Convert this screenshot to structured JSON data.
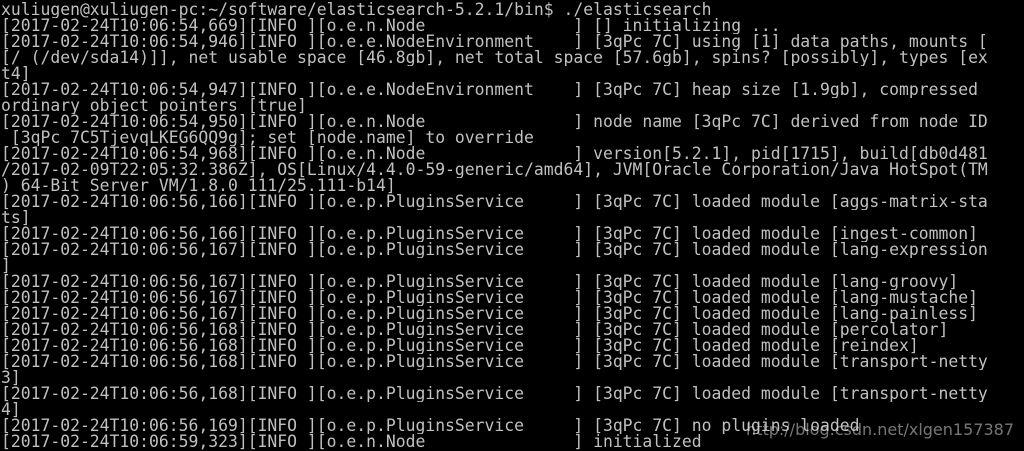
{
  "terminal": {
    "colors": {
      "background": "#000000",
      "foreground": "#c0c0c0"
    },
    "lines": [
      "xuliugen@xuliugen-pc:~/software/elasticsearch-5.2.1/bin$ ./elasticsearch",
      "[2017-02-24T10:06:54,669][INFO ][o.e.n.Node               ] [] initializing ...",
      "[2017-02-24T10:06:54,946][INFO ][o.e.e.NodeEnvironment    ] [3qPc_7C] using [1] data paths, mounts [",
      "[/ (/dev/sda14)]], net usable_space [46.8gb], net total_space [57.6gb], spins? [possibly], types [ex",
      "t4]",
      "[2017-02-24T10:06:54,947][INFO ][o.e.e.NodeEnvironment    ] [3qPc_7C] heap size [1.9gb], compressed",
      "ordinary object pointers [true]",
      "[2017-02-24T10:06:54,950][INFO ][o.e.n.Node               ] node name [3qPc_7C] derived from node ID",
      " [3qPc_7C5TjevqLKEG6QQ9g]; set [node.name] to override",
      "[2017-02-24T10:06:54,968][INFO ][o.e.n.Node               ] version[5.2.1], pid[1715], build[db0d481",
      "/2017-02-09T22:05:32.386Z], OS[Linux/4.4.0-59-generic/amd64], JVM[Oracle Corporation/Java HotSpot(TM",
      ") 64-Bit Server VM/1.8.0_111/25.111-b14]",
      "[2017-02-24T10:06:56,166][INFO ][o.e.p.PluginsService     ] [3qPc_7C] loaded module [aggs-matrix-sta",
      "ts]",
      "[2017-02-24T10:06:56,166][INFO ][o.e.p.PluginsService     ] [3qPc_7C] loaded module [ingest-common]",
      "[2017-02-24T10:06:56,167][INFO ][o.e.p.PluginsService     ] [3qPc_7C] loaded module [lang-expression",
      "]",
      "[2017-02-24T10:06:56,167][INFO ][o.e.p.PluginsService     ] [3qPc_7C] loaded module [lang-groovy]",
      "[2017-02-24T10:06:56,167][INFO ][o.e.p.PluginsService     ] [3qPc_7C] loaded module [lang-mustache]",
      "[2017-02-24T10:06:56,167][INFO ][o.e.p.PluginsService     ] [3qPc_7C] loaded module [lang-painless]",
      "[2017-02-24T10:06:56,168][INFO ][o.e.p.PluginsService     ] [3qPc_7C] loaded module [percolator]",
      "[2017-02-24T10:06:56,168][INFO ][o.e.p.PluginsService     ] [3qPc_7C] loaded module [reindex]",
      "[2017-02-24T10:06:56,168][INFO ][o.e.p.PluginsService     ] [3qPc_7C] loaded module [transport-netty",
      "3]",
      "[2017-02-24T10:06:56,168][INFO ][o.e.p.PluginsService     ] [3qPc_7C] loaded module [transport-netty",
      "4]",
      "[2017-02-24T10:06:56,169][INFO ][o.e.p.PluginsService     ] [3qPc_7C] no plugins loaded",
      "[2017-02-24T10:06:59,323][INFO ][o.e.n.Node               ] initialized"
    ]
  },
  "watermark": {
    "text": "http://blog.csdn.net/xlgen157387"
  }
}
